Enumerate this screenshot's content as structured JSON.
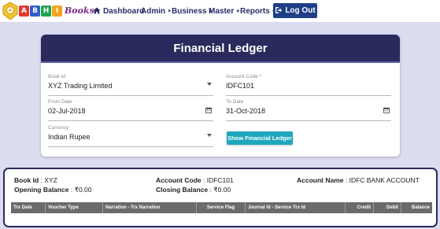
{
  "brand": {
    "letters": [
      "A",
      "B",
      "H",
      "I"
    ],
    "letter_colors": [
      "#e23a2e",
      "#2f5fc4",
      "#1fa34a",
      "#f2a51c"
    ],
    "tail": "Books",
    "emblem_color": "#f2c230"
  },
  "nav": {
    "dashboard": "Dashboard",
    "admin": "Admin",
    "business": "Business",
    "master": "Master",
    "reports": "Reports",
    "logout": "Log Out"
  },
  "form": {
    "title": "Financial Ledger",
    "book_id": {
      "label": "Book Id",
      "value": "XYZ Trading Limited"
    },
    "account_code": {
      "label": "Account Code *",
      "value": "IDFC101"
    },
    "from_date": {
      "label": "From Date",
      "value": "02-Jul-2018"
    },
    "to_date": {
      "label": "To Date",
      "value": "31-Oct-2018"
    },
    "currency": {
      "label": "Currency",
      "value": "Indian Rupee"
    },
    "show_button": "Show Financial Ledger"
  },
  "result": {
    "book_id_label": "Book Id",
    "book_id_value": ": XYZ",
    "account_code_label": "Account Code",
    "account_code_value": ": IDFC101",
    "account_name_label": "Account Name",
    "account_name_value": ": IDFC BANK ACCOUNT",
    "opening_balance_label": "Opening Balance",
    "opening_balance_value": ": ₹0.00",
    "closing_balance_label": "Closing Balance",
    "closing_balance_value": ": ₹0.00",
    "columns": [
      "Trx Date",
      "Voucher Type",
      "Narration - Trx Narration",
      "Service Flag",
      "Journal Id - Service Trx Id",
      "Credit",
      "Debit",
      "Balance"
    ]
  },
  "colors": {
    "header_bg": "#2a2b5c",
    "nav_text": "#2b2c6b",
    "logout_bg": "#1e3f86",
    "show_button_bg": "#1fa7bd",
    "page_bg": "#dcdcf1"
  }
}
